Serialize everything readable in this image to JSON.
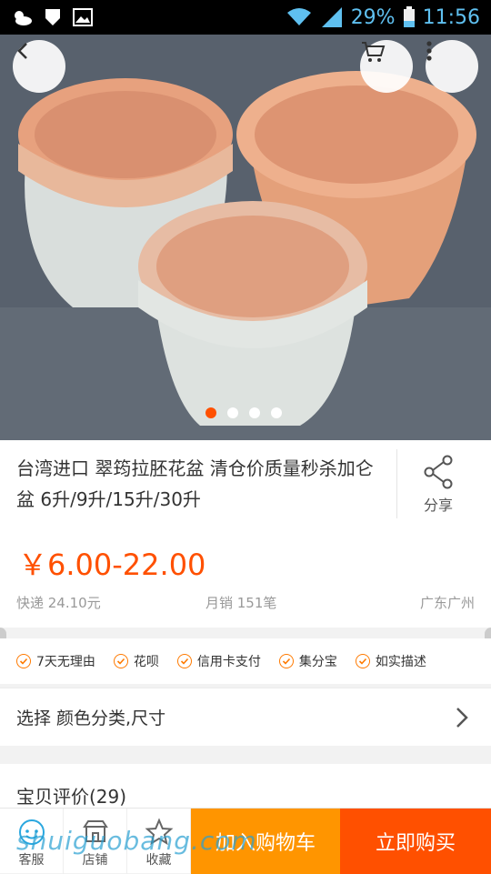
{
  "status_bar": {
    "battery": "29%",
    "time": "11:56"
  },
  "gallery": {
    "page_count": 4,
    "active_index": 0
  },
  "product": {
    "title": "台湾进口 翠筠拉胚花盆 清仓价质量秒杀加仑盆 6升/9升/15升/30升",
    "share_label": "分享",
    "price": "￥6.00-22.00",
    "shipping": "快递 24.10元",
    "monthly_sales": "月销 151笔",
    "location": "广东广州"
  },
  "services": [
    {
      "label": "7天无理由",
      "icon": "check-circle-icon"
    },
    {
      "label": "花呗",
      "icon": "check-circle-icon"
    },
    {
      "label": "信用卡支付",
      "icon": "check-circle-icon"
    },
    {
      "label": "集分宝",
      "icon": "check-circle-icon"
    },
    {
      "label": "如实描述",
      "icon": "check-circle-icon"
    }
  ],
  "selection": {
    "label": "选择 颜色分类,尺寸"
  },
  "reviews": {
    "label": "宝贝评价(29)"
  },
  "bottom_bar": {
    "service_label": "客服",
    "shop_label": "店铺",
    "favorite_label": "收藏",
    "add_cart_label": "加入购物车",
    "buy_now_label": "立即购买"
  },
  "watermark": "shuiguobang.com",
  "colors": {
    "accent": "#ff5000",
    "cart": "#ff9500"
  }
}
